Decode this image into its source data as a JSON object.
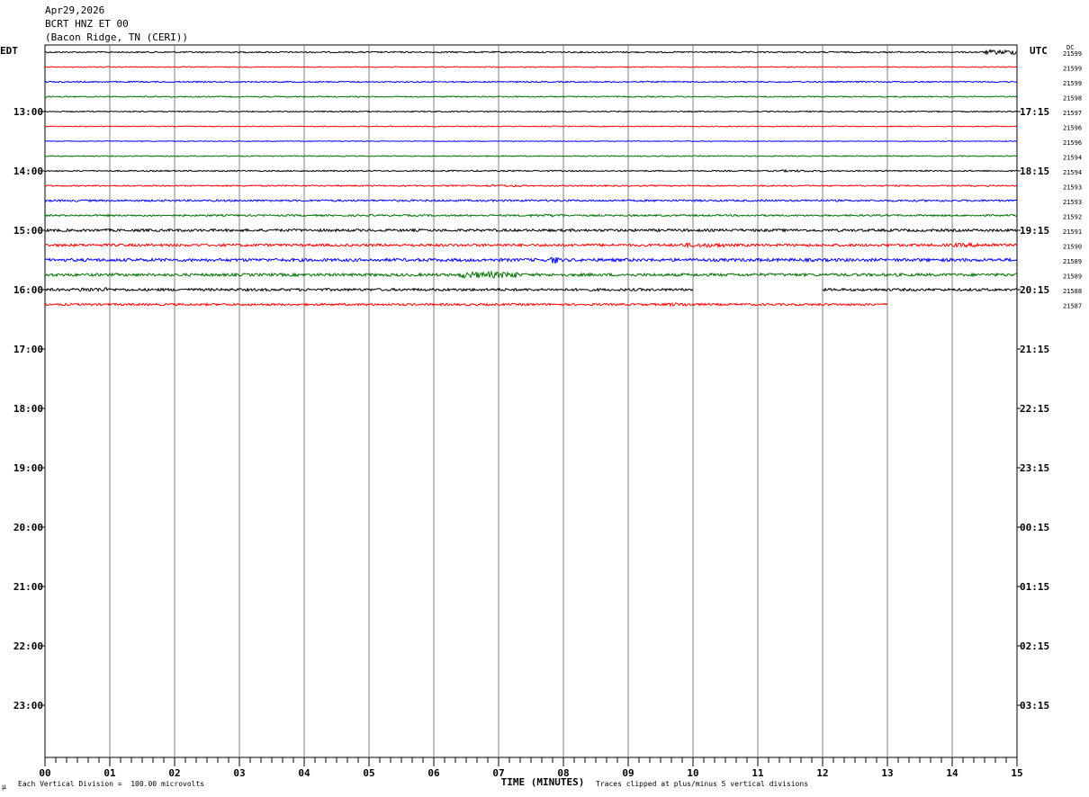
{
  "header": {
    "date": "Apr29,2026",
    "station": "BCRT HNZ ET 00",
    "location": "(Bacon Ridge, TN (CERI))"
  },
  "left_axis_label": "EDT",
  "right_axis_label": "UTC",
  "dc_label": "DC",
  "footer": {
    "scale_note": "Each Vertical Division =  100.00 microvolts",
    "corner_mark": "µ",
    "clip_note": "Traces clipped at plus/minus 5 vertical divisions"
  },
  "chart_data": {
    "type": "line",
    "title": "",
    "xlabel": "TIME (MINUTES)",
    "ylabel": "",
    "x_ticks": [
      "00",
      "01",
      "02",
      "03",
      "04",
      "05",
      "06",
      "07",
      "08",
      "09",
      "10",
      "11",
      "12",
      "13",
      "14",
      "15"
    ],
    "xlim": [
      0,
      15
    ],
    "grid": true,
    "edt_labels": [
      "13:00",
      "14:00",
      "15:00",
      "16:00",
      "17:00",
      "18:00",
      "19:00",
      "20:00",
      "21:00",
      "22:00",
      "23:00"
    ],
    "utc_labels": [
      "17:15",
      "18:15",
      "19:15",
      "20:15",
      "21:15",
      "22:15",
      "23:15",
      "00:15",
      "01:15",
      "02:15",
      "03:15"
    ],
    "trace_colors": [
      "#000000",
      "#ff0000",
      "#0000ff",
      "#007000"
    ],
    "traces": [
      {
        "row": 0,
        "dc": "21599",
        "color": "#000000",
        "noise": 1.0,
        "segments": [
          [
            0,
            15
          ]
        ],
        "bursts": [
          [
            14.5,
            15,
            3
          ]
        ]
      },
      {
        "row": 1,
        "dc": "21599",
        "color": "#ff0000",
        "noise": 0.6,
        "segments": [
          [
            0,
            15
          ]
        ],
        "bursts": []
      },
      {
        "row": 2,
        "dc": "21599",
        "color": "#0000ff",
        "noise": 0.9,
        "segments": [
          [
            0,
            15
          ]
        ],
        "bursts": []
      },
      {
        "row": 3,
        "dc": "21598",
        "color": "#007000",
        "noise": 0.8,
        "segments": [
          [
            0,
            15
          ]
        ],
        "bursts": []
      },
      {
        "row": 4,
        "dc": "21597",
        "color": "#000000",
        "noise": 0.8,
        "segments": [
          [
            0,
            15
          ]
        ],
        "bursts": []
      },
      {
        "row": 5,
        "dc": "21596",
        "color": "#ff0000",
        "noise": 0.6,
        "segments": [
          [
            0,
            15
          ]
        ],
        "bursts": []
      },
      {
        "row": 6,
        "dc": "21596",
        "color": "#0000ff",
        "noise": 0.5,
        "segments": [
          [
            0,
            15
          ]
        ],
        "bursts": []
      },
      {
        "row": 7,
        "dc": "21594",
        "color": "#007000",
        "noise": 0.7,
        "segments": [
          [
            0,
            15
          ]
        ],
        "bursts": []
      },
      {
        "row": 8,
        "dc": "21594",
        "color": "#000000",
        "noise": 0.9,
        "segments": [
          [
            0,
            15
          ]
        ],
        "bursts": [
          [
            11.3,
            12,
            1.6
          ]
        ]
      },
      {
        "row": 9,
        "dc": "21593",
        "color": "#ff0000",
        "noise": 0.9,
        "segments": [
          [
            0,
            15
          ]
        ],
        "bursts": [
          [
            6.8,
            7.4,
            1.6
          ]
        ]
      },
      {
        "row": 10,
        "dc": "21593",
        "color": "#0000ff",
        "noise": 1.3,
        "segments": [
          [
            0,
            15
          ]
        ],
        "bursts": []
      },
      {
        "row": 11,
        "dc": "21592",
        "color": "#007000",
        "noise": 1.2,
        "segments": [
          [
            0,
            15
          ]
        ],
        "bursts": [
          [
            7.5,
            8,
            1.5
          ]
        ]
      },
      {
        "row": 12,
        "dc": "21591",
        "color": "#000000",
        "noise": 1.8,
        "segments": [
          [
            0,
            15
          ]
        ],
        "bursts": []
      },
      {
        "row": 13,
        "dc": "21590",
        "color": "#ff0000",
        "noise": 1.8,
        "segments": [
          [
            0,
            15
          ]
        ],
        "bursts": [
          [
            9.8,
            10.5,
            1.6
          ],
          [
            14,
            14.7,
            1.5
          ]
        ]
      },
      {
        "row": 14,
        "dc": "21589",
        "color": "#0000ff",
        "noise": 2.1,
        "segments": [
          [
            0,
            15
          ]
        ],
        "bursts": [
          [
            7.8,
            7.95,
            2.5
          ]
        ]
      },
      {
        "row": 15,
        "dc": "21589",
        "color": "#007000",
        "noise": 2.0,
        "segments": [
          [
            0,
            15
          ]
        ],
        "bursts": [
          [
            6.4,
            7.3,
            2.2
          ]
        ]
      },
      {
        "row": 16,
        "dc": "21588",
        "color": "#000000",
        "noise": 1.8,
        "segments": [
          [
            0,
            10
          ],
          [
            12,
            15
          ]
        ],
        "bursts": [
          [
            0.5,
            1,
            1.6
          ]
        ]
      },
      {
        "row": 17,
        "dc": "21587",
        "color": "#ff0000",
        "noise": 1.5,
        "segments": [
          [
            0,
            13
          ]
        ],
        "bursts": [
          [
            9.6,
            10,
            1.6
          ]
        ]
      }
    ]
  }
}
